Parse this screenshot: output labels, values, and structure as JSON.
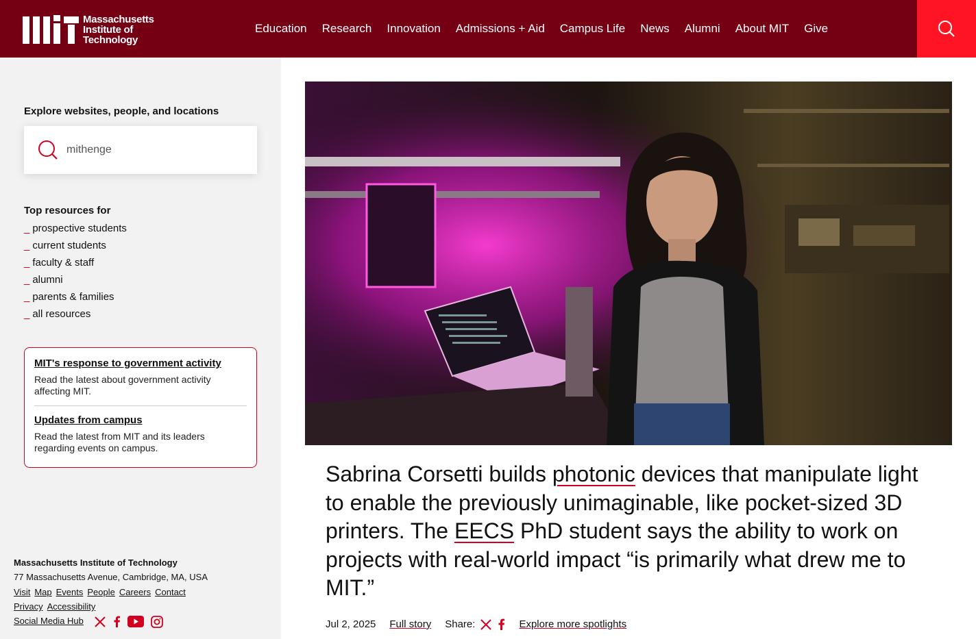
{
  "header": {
    "logo_lines": [
      "Massachusetts",
      "Institute of",
      "Technology"
    ],
    "nav": [
      "Education",
      "Research",
      "Innovation",
      "Admissions + Aid",
      "Campus Life",
      "News",
      "Alumni",
      "About MIT",
      "Give"
    ],
    "search_icon": "search-icon"
  },
  "sidebar": {
    "explore_title": "Explore websites, people, and locations",
    "search_value": "mithenge",
    "top_resources_title": "Top resources for",
    "resources": [
      "prospective students",
      "current students",
      "faculty & staff",
      "alumni",
      "parents & families",
      "all resources"
    ],
    "notices": [
      {
        "title": "MIT's response to government activity",
        "desc": "Read the latest about government activity affecting MIT."
      },
      {
        "title": "Updates from campus",
        "desc": "Read the latest from MIT and its leaders regarding events on campus."
      }
    ],
    "footer": {
      "org": "Massachusetts Institute of Technology",
      "address": "77 Massachusetts Avenue, Cambridge, MA, USA",
      "links_row1": [
        "Visit",
        "Map",
        "Events",
        "People",
        "Careers",
        "Contact"
      ],
      "links_row2": [
        "Privacy",
        "Accessibility"
      ],
      "social_hub": "Social Media Hub",
      "social_icons": [
        "x-icon",
        "facebook-icon",
        "youtube-icon",
        "instagram-icon"
      ]
    }
  },
  "main": {
    "headline_parts": [
      "Sabrina Corsetti builds ",
      "photonic",
      " devices that manipulate light to enable the previously unimaginable, like pocket-sized 3D printers. The ",
      "EECS",
      " PhD student says the ability to work on projects with real-world impact   “is primarily what drew me to MIT.”"
    ],
    "date": "Jul 2, 2025",
    "full_story": "Full story",
    "share_label": "Share:",
    "explore_more": "Explore more spotlights"
  },
  "colors": {
    "brand": "#750014",
    "accent": "#d10020",
    "search_bg": "#ff1423"
  }
}
